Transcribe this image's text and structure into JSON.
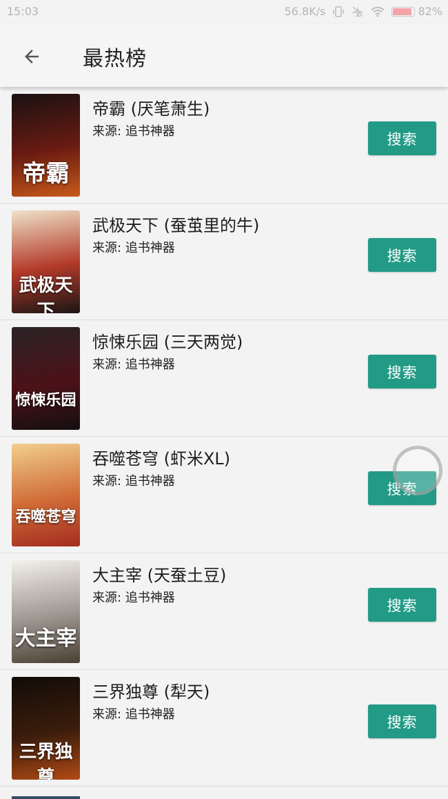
{
  "status_bar": {
    "time": "15:03",
    "net_speed": "56.8K/s",
    "battery": "82%",
    "battery_level": 0.82,
    "battery_color": "#f4a3a8"
  },
  "app_bar": {
    "back_icon": "arrow-left-icon",
    "title": "最热榜"
  },
  "colors": {
    "accent": "#229a86",
    "background": "#f3f3f3"
  },
  "books": [
    {
      "title": "帝霸 (厌笔萧生)",
      "source": "来源: 追书神器",
      "button": "搜索",
      "cover_text": "帝霸",
      "cover_gradient": [
        "#1a1111",
        "#6a1b12",
        "#c85a1a"
      ]
    },
    {
      "title": "武极天下 (蚕茧里的牛)",
      "source": "来源: 追书神器",
      "button": "搜索",
      "cover_text": "武极天下",
      "cover_gradient": [
        "#efe2c8",
        "#b33a2a",
        "#1a1614"
      ]
    },
    {
      "title": "惊悚乐园 (三天两觉)",
      "source": "来源: 追书神器",
      "button": "搜索",
      "cover_text": "惊悚乐园",
      "cover_gradient": [
        "#2a2326",
        "#4c1218",
        "#150f10"
      ]
    },
    {
      "title": "吞噬苍穹 (虾米XL)",
      "source": "来源: 追书神器",
      "button": "搜索",
      "cover_text": "吞噬苍穹",
      "cover_gradient": [
        "#f1cf8d",
        "#d06b37",
        "#a32d1f"
      ]
    },
    {
      "title": "大主宰 (天蚕土豆)",
      "source": "来源: 追书神器",
      "button": "搜索",
      "cover_text": "大主宰",
      "cover_gradient": [
        "#f4f1ea",
        "#9c9790",
        "#4a3f33"
      ]
    },
    {
      "title": "三界独尊 (犁天)",
      "source": "来源: 追书神器",
      "button": "搜索",
      "cover_text": "三界独尊",
      "cover_gradient": [
        "#120c08",
        "#3b1d0c",
        "#b24a14"
      ]
    }
  ]
}
